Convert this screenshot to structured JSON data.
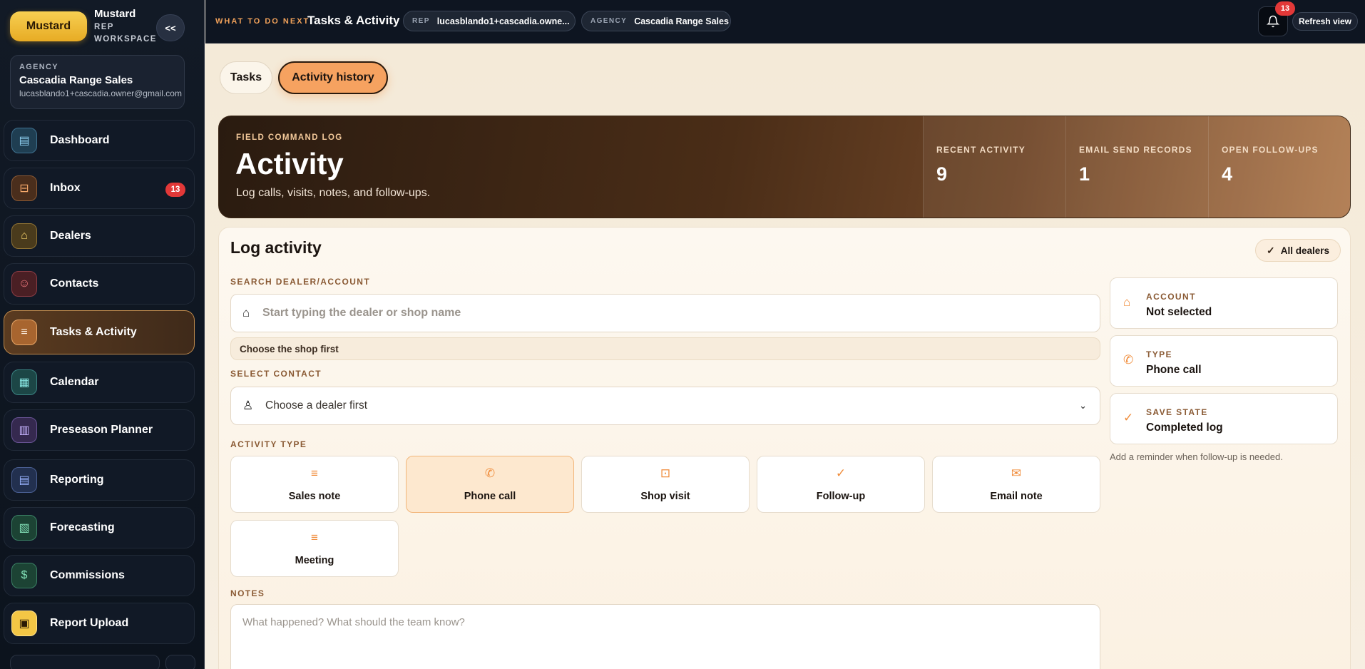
{
  "brand": {
    "logo_label": "Mustard",
    "title": "Mustard",
    "subtitle": "REP WORKSPACE",
    "collapse_label": "<<"
  },
  "agency_card": {
    "label": "AGENCY",
    "name": "Cascadia Range Sales",
    "email": "lucasblando1+cascadia.owner@gmail.com"
  },
  "nav": {
    "items": [
      {
        "label": "Dashboard",
        "icon": "dashboard-icon"
      },
      {
        "label": "Inbox",
        "icon": "inbox-icon",
        "badge": "13"
      },
      {
        "label": "Dealers",
        "icon": "home-icon"
      },
      {
        "label": "Contacts",
        "icon": "contacts-icon"
      },
      {
        "label": "Tasks & Activity",
        "icon": "tasks-icon",
        "active": true
      },
      {
        "label": "Calendar",
        "icon": "calendar-icon"
      },
      {
        "label": "Preseason Planner",
        "icon": "book-icon"
      },
      {
        "label": "Reporting",
        "icon": "report-icon"
      },
      {
        "label": "Forecasting",
        "icon": "forecast-icon"
      },
      {
        "label": "Commissions",
        "icon": "dollar-icon"
      },
      {
        "label": "Report Upload",
        "icon": "upload-icon"
      }
    ]
  },
  "topbar": {
    "eyebrow": "WHAT TO DO NEXT",
    "title": "Tasks & Activity",
    "rep_key": "REP",
    "rep_value": "lucasblando1+cascadia.owne...",
    "agency_key": "AGENCY",
    "agency_value": "Cascadia Range Sales",
    "notification_count": "13",
    "refresh_label": "Refresh view"
  },
  "tabs": {
    "tasks": "Tasks",
    "activity_history": "Activity history"
  },
  "hero": {
    "eyebrow": "FIELD COMMAND LOG",
    "title": "Activity",
    "subtitle": "Log calls, visits, notes, and follow-ups.",
    "stats": [
      {
        "label": "RECENT ACTIVITY",
        "value": "9"
      },
      {
        "label": "EMAIL SEND RECORDS",
        "value": "1"
      },
      {
        "label": "OPEN FOLLOW-UPS",
        "value": "4"
      }
    ]
  },
  "log": {
    "title": "Log activity",
    "all_dealers_label": "All dealers",
    "search_label": "SEARCH DEALER/ACCOUNT",
    "search_placeholder": "Start typing the dealer or shop name",
    "search_hint": "Choose the shop first",
    "contact_label": "SELECT CONTACT",
    "contact_value": "Choose a dealer first",
    "type_label": "ACTIVITY TYPE",
    "types": [
      {
        "label": "Sales note",
        "icon": "list-icon"
      },
      {
        "label": "Phone call",
        "icon": "phone-icon",
        "selected": true
      },
      {
        "label": "Shop visit",
        "icon": "store-icon"
      },
      {
        "label": "Follow-up",
        "icon": "check-icon"
      },
      {
        "label": "Email note",
        "icon": "mail-icon"
      },
      {
        "label": "Meeting",
        "icon": "list-icon"
      }
    ],
    "notes_label": "NOTES",
    "notes_placeholder": "What happened? What should the team know?"
  },
  "summary": {
    "account": {
      "label": "ACCOUNT",
      "value": "Not selected"
    },
    "type": {
      "label": "TYPE",
      "value": "Phone call"
    },
    "save_state": {
      "label": "SAVE STATE",
      "value": "Completed log"
    },
    "note": "Add a reminder when follow-up is needed."
  },
  "colors": {
    "accent": "#f6a260",
    "brand": "#f3c645",
    "badge": "#e23838",
    "sidebar": "#0e1521"
  }
}
